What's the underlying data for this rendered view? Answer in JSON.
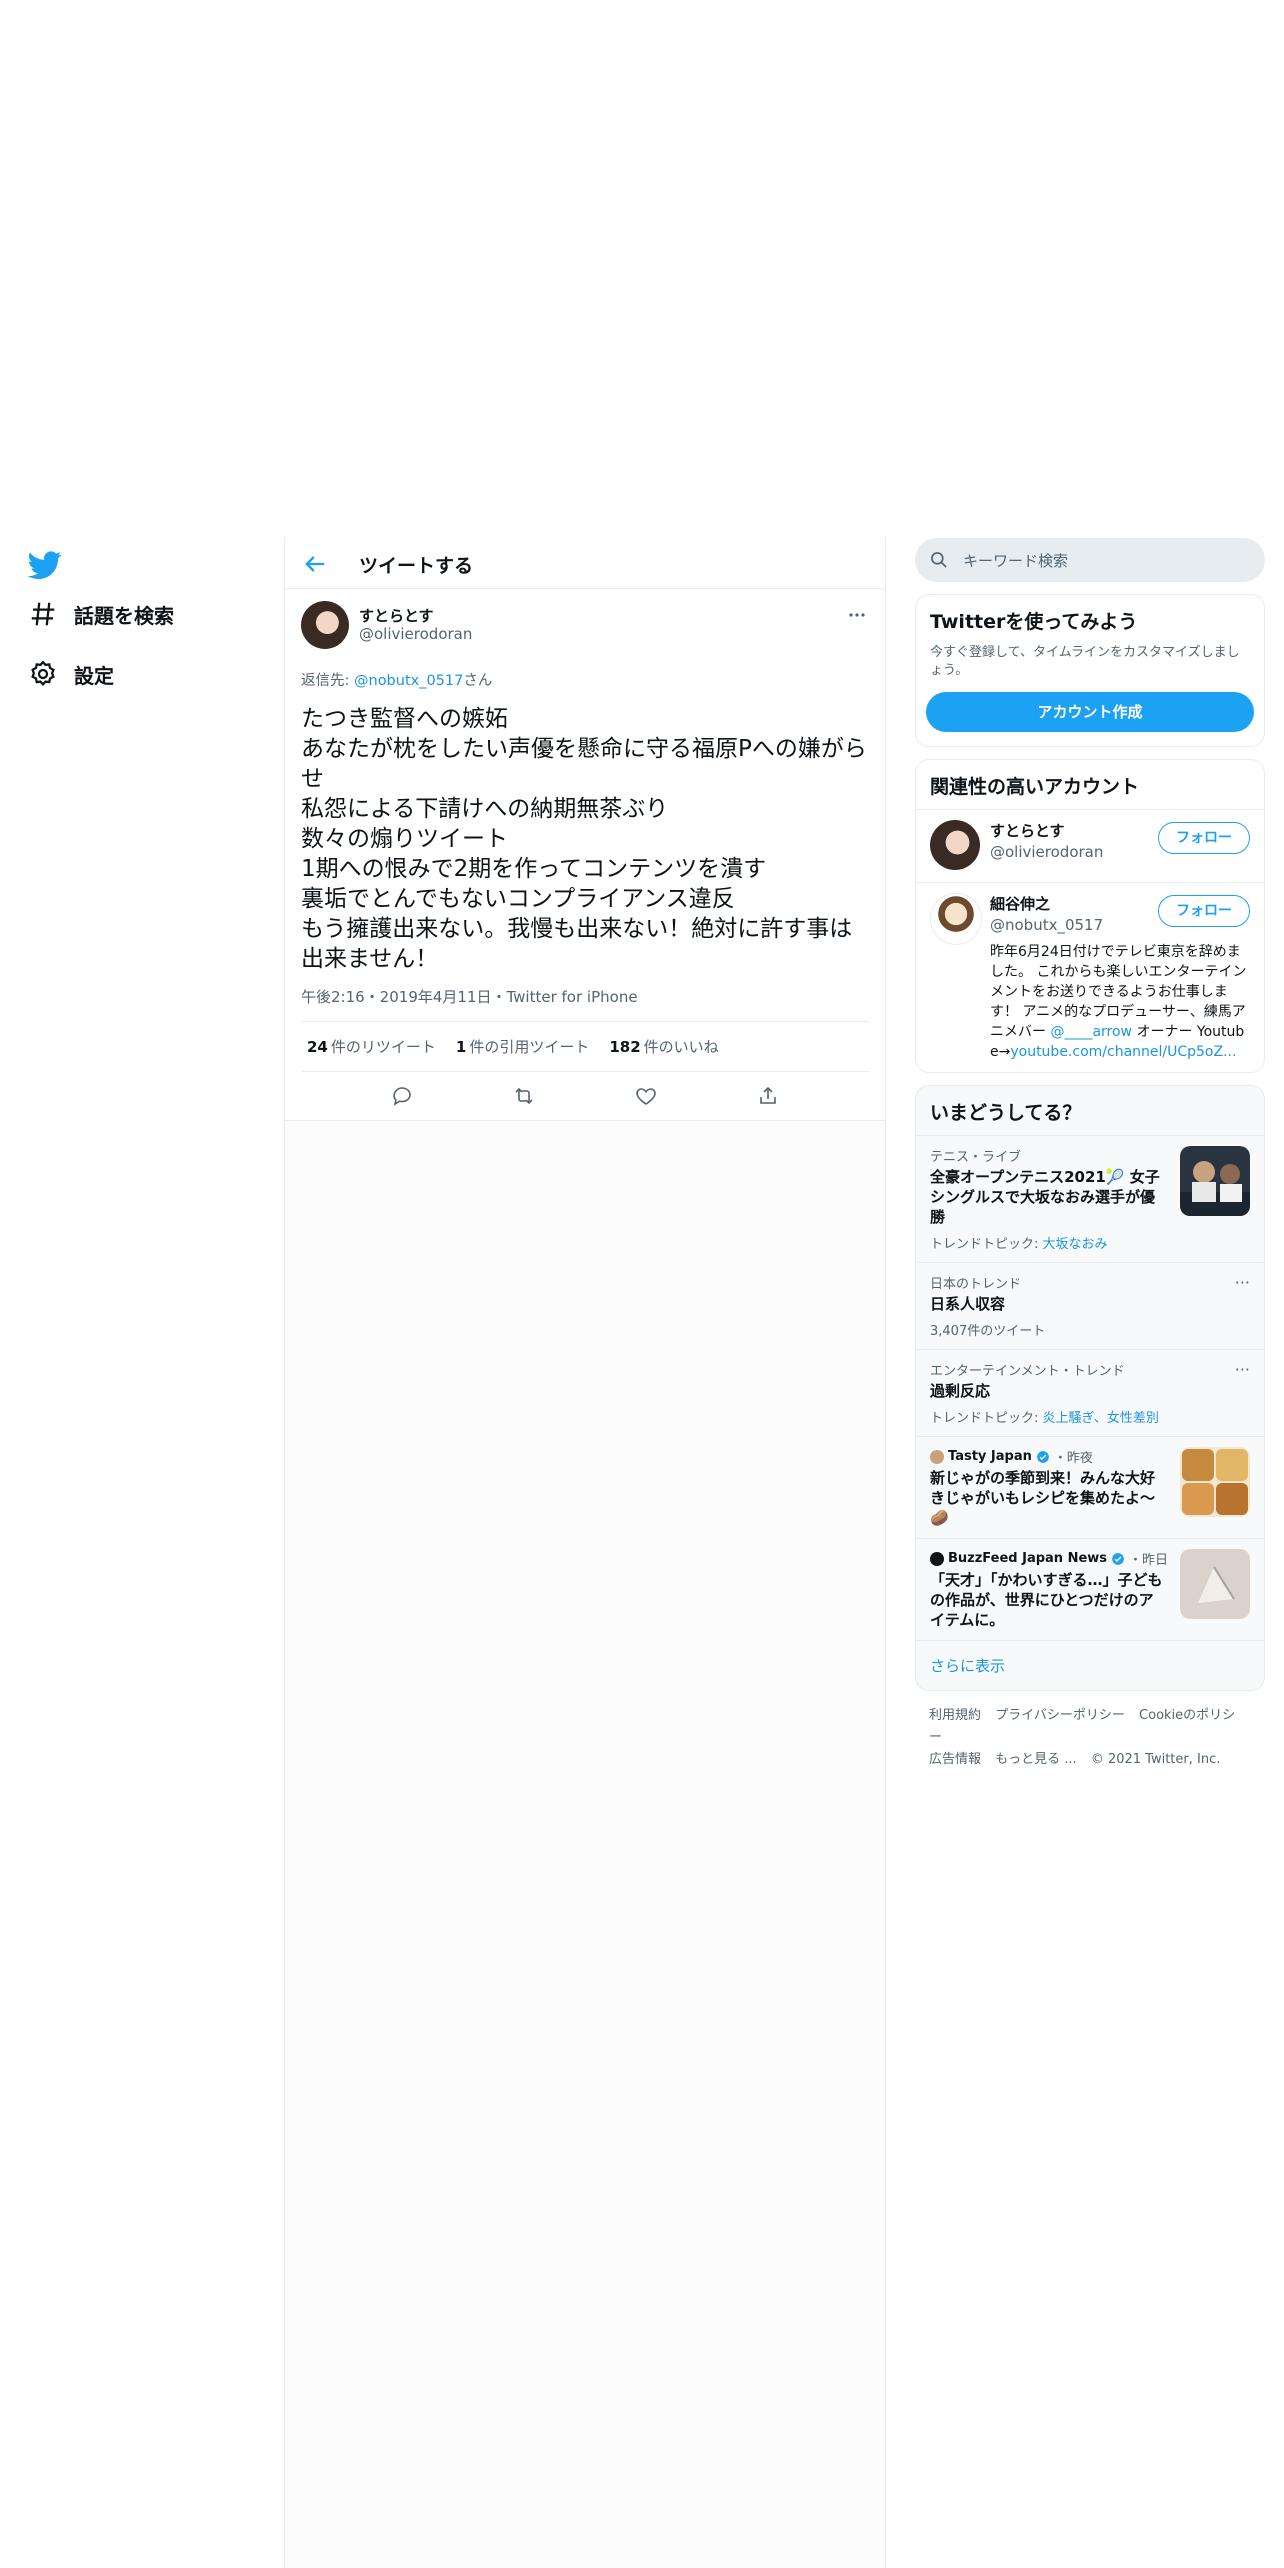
{
  "nav": {
    "items": [
      {
        "label": "話題を検索"
      },
      {
        "label": "設定"
      }
    ]
  },
  "header": {
    "title": "ツイートする"
  },
  "tweet": {
    "author_name": "すとらとす",
    "author_handle": "@olivierodoran",
    "reply_prefix": "返信先: ",
    "reply_mention": "@nobutx_0517",
    "reply_suffix": "さん",
    "text": "たつき監督への嫉妬\nあなたが枕をしたい声優を懸命に守る福原Pへの嫌がらせ\n私怨による下請けへの納期無茶ぶり\n数々の煽りツイート\n1期への恨みで2期を作ってコンテンツを潰す\n裏垢でとんでもないコンプライアンス違反\nもう擁護出来ない。我慢も出来ない！絶対に許す事は出来ません！",
    "meta": "午後2:16・2019年4月11日・Twitter for iPhone",
    "stats": {
      "retweets_count": "24",
      "retweets_label": "件のリツイート",
      "quotes_count": "1",
      "quotes_label": "件の引用ツイート",
      "likes_count": "182",
      "likes_label": "件のいいね"
    }
  },
  "search": {
    "placeholder": "キーワード検索"
  },
  "signup": {
    "title": "Twitterを使ってみよう",
    "desc": "今すぐ登録して、タイムラインをカスタマイズしましょう。",
    "button": "アカウント作成"
  },
  "related": {
    "title": "関連性の高いアカウント",
    "accounts": [
      {
        "name": "すとらとす",
        "handle": "@olivierodoran",
        "follow": "フォロー"
      },
      {
        "name": "細谷伸之",
        "handle": "@nobutx_0517",
        "follow": "フォロー",
        "bio_text": "昨年6月24日付けでテレビ東京を辞めました。 これからも楽しいエンターテインメントをお送りできるようお仕事します！ アニメ的なプロデューサー、練馬アニメバー ",
        "bio_mention": "@____arrow",
        "bio_mid": " オーナー Youtube→",
        "bio_link": "youtube.com/channel/UCp5oZ..."
      }
    ]
  },
  "trends": {
    "title": "いまどうしてる？",
    "items": [
      {
        "category": "テニス・ライブ",
        "title": "全豪オープンテニス2021🎾 女子シングルスで大坂なおみ選手が優勝",
        "sub_prefix": "トレンドトピック: ",
        "sub_link": "大坂なおみ"
      },
      {
        "category": "日本のトレンド",
        "title": "日系人収容",
        "sub_plain": "3,407件のツイート",
        "more": "···"
      },
      {
        "category": "エンターテインメント・トレンド",
        "title": "過剰反応",
        "sub_prefix": "トレンドトピック: ",
        "sub_link": "炎上騒ぎ、女性差別",
        "more": "···"
      },
      {
        "source": "Tasty Japan",
        "time": "・昨夜",
        "title": "新じゃがの季節到来！みんな大好きじゃがいもレシピを集めたよ〜🥔"
      },
      {
        "source": "BuzzFeed Japan News",
        "time": "・昨日",
        "title": "「天才」「かわいすぎる…」子どもの作品が、世界にひとつだけのアイテムに。"
      }
    ],
    "show_more": "さらに表示"
  },
  "footer": {
    "links": [
      "利用規約",
      "プライバシーポリシー",
      "Cookieのポリシー",
      "広告情報",
      "もっと見る ...",
      "© 2021 Twitter, Inc."
    ]
  },
  "colors": {
    "accent": "#1da1f2",
    "link": "#1b95e0",
    "border": "#e6ecf0",
    "muted": "#536471"
  }
}
